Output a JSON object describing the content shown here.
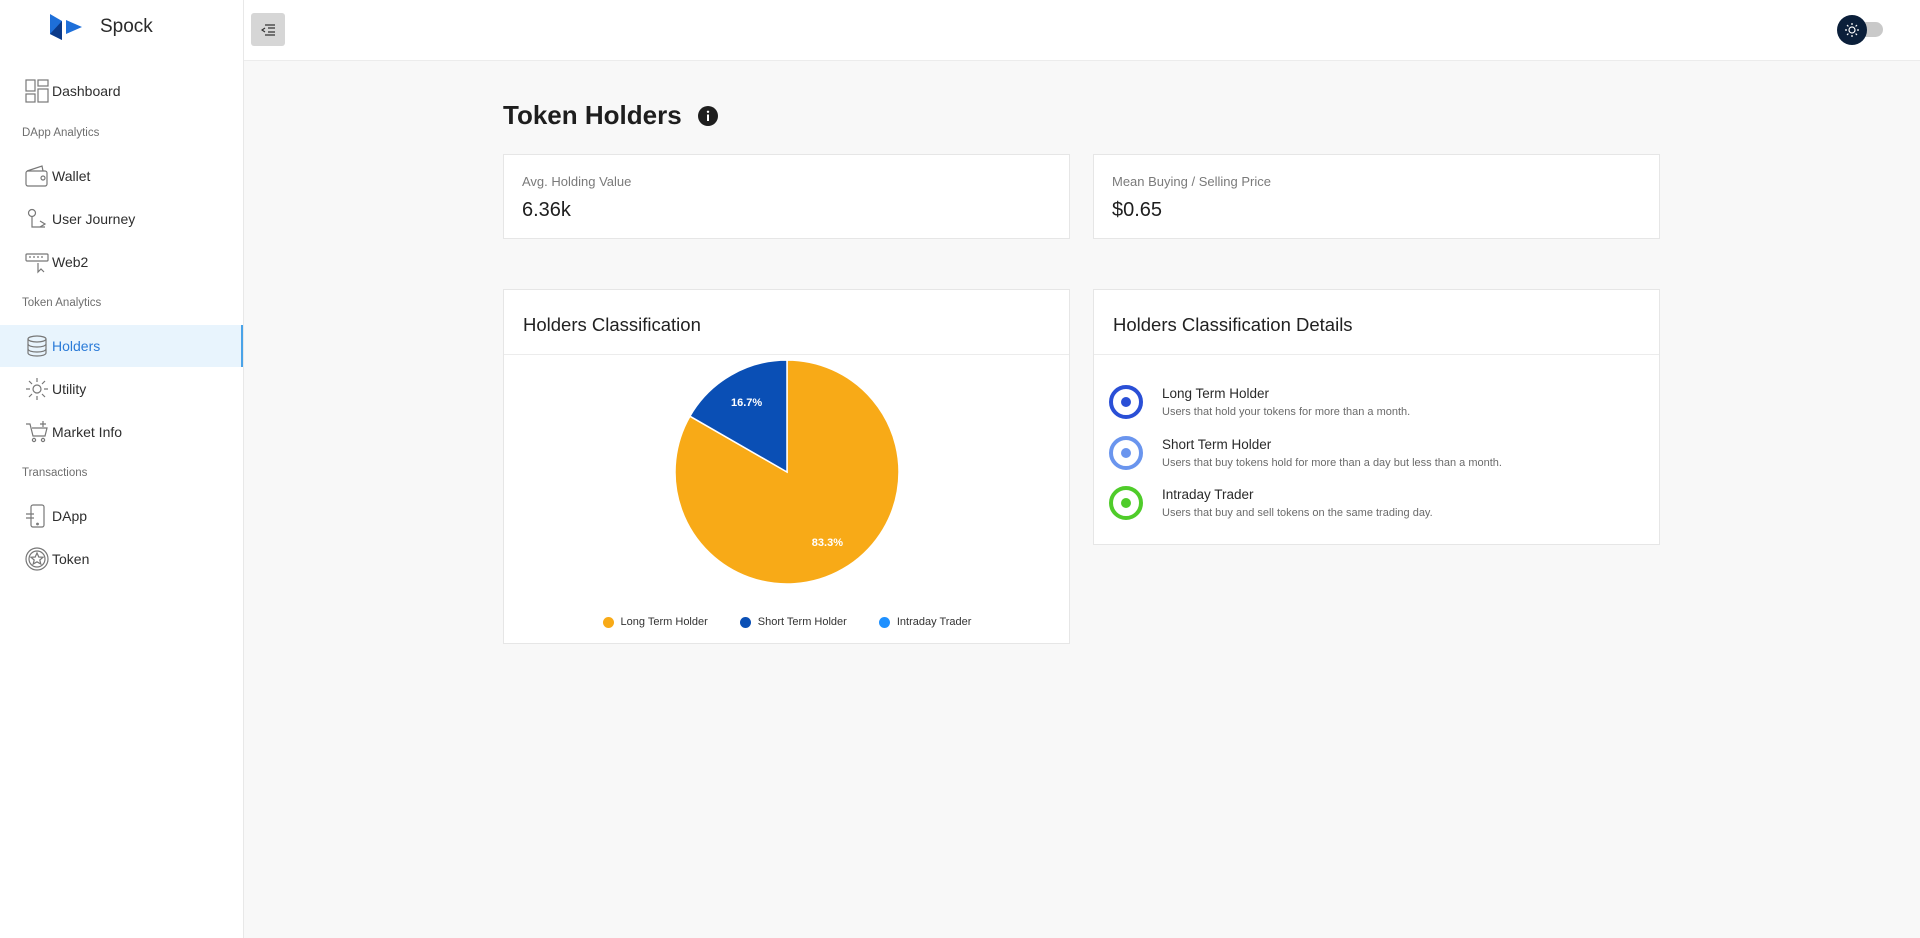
{
  "app": {
    "name": "Spock"
  },
  "sidebar": {
    "dashboard": "Dashboard",
    "sections": {
      "dapp_analytics": "DApp Analytics",
      "token_analytics": "Token Analytics",
      "transactions": "Transactions"
    },
    "items": {
      "wallet": "Wallet",
      "user_journey": "User Journey",
      "web2": "Web2",
      "holders": "Holders",
      "utility": "Utility",
      "market_info": "Market Info",
      "dapp": "DApp",
      "token": "Token"
    },
    "active": "holders"
  },
  "page": {
    "title": "Token Holders"
  },
  "stats": [
    {
      "label": "Avg. Holding Value",
      "value": "6.36k"
    },
    {
      "label": "Mean Buying / Selling Price",
      "value": "$0.65"
    }
  ],
  "classification": {
    "title": "Holders Classification",
    "chart_data": {
      "type": "pie",
      "categories": [
        "Long Term Holder",
        "Short Term Holder",
        "Intraday Trader"
      ],
      "values": [
        83.3,
        16.7,
        0
      ],
      "labels": [
        "83.3%",
        "16.7%",
        ""
      ],
      "colors": [
        "#f8aa17",
        "#0a4fb5",
        "#1e90ff"
      ],
      "legend": "bottom"
    }
  },
  "details": {
    "title": "Holders Classification Details",
    "rows": [
      {
        "title": "Long Term Holder",
        "desc": "Users that hold your tokens for more than a month.",
        "ring_color": "#2a4fd6"
      },
      {
        "title": "Short Term Holder",
        "desc": "Users that buy tokens hold for more than a day but less than a month.",
        "ring_color": "#6a95ee"
      },
      {
        "title": "Intraday Trader",
        "desc": "Users that buy and sell tokens on the same trading day.",
        "ring_color": "#4fcc2a"
      }
    ]
  },
  "colors": {
    "accent": "#2b7bd8",
    "active_bg": "#e8f4fd",
    "theme_knob": "#0b1f3a"
  }
}
